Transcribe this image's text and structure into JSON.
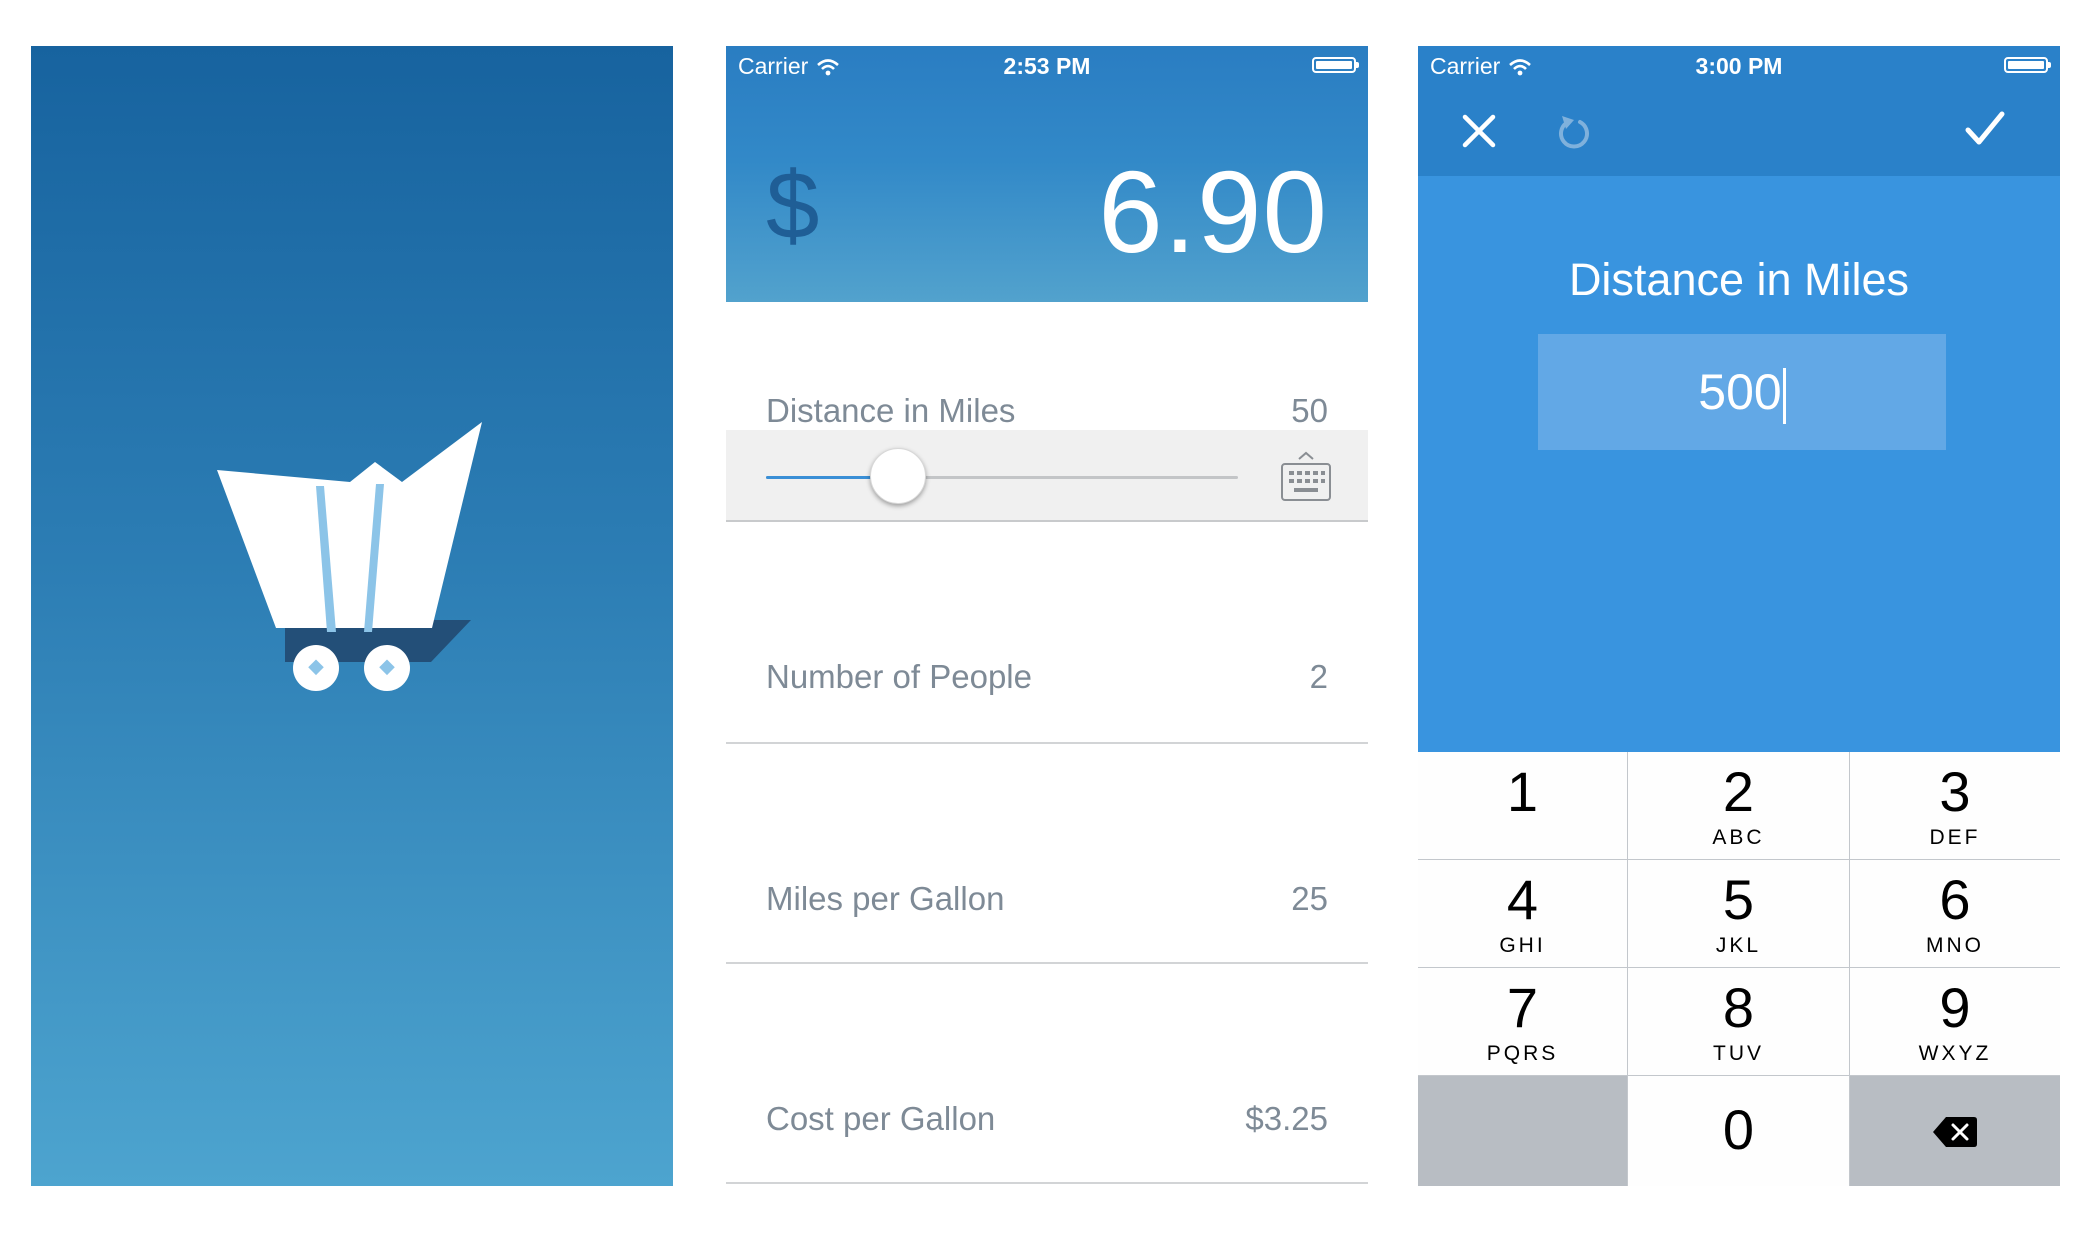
{
  "splash": {
    "colors": {
      "top": "#17639f",
      "bottom": "#4da4cf"
    },
    "logo_icon": "wagon-cart-logo-icon"
  },
  "calculator": {
    "status": {
      "carrier": "Carrier",
      "time": "2:53 PM"
    },
    "currency_symbol": "$",
    "total": "6.90",
    "rows": [
      {
        "label": "Distance in Miles",
        "value": "50"
      },
      {
        "label": "Number of People",
        "value": "2"
      },
      {
        "label": "Miles per Gallon",
        "value": "25"
      },
      {
        "label": "Cost per Gallon",
        "value": "$3.25"
      }
    ],
    "slider": {
      "fraction": 0.28
    },
    "keyboard_toggle_icon": "keyboard-icon",
    "colors": {
      "header_top": "#2a7dc2",
      "header_bottom": "#52a2cd",
      "text": "#7e8a96"
    }
  },
  "entry": {
    "status": {
      "carrier": "Carrier",
      "time": "3:00 PM"
    },
    "toolbar": {
      "close_icon": "close-icon",
      "reset_icon": "undo-icon",
      "confirm_icon": "checkmark-icon"
    },
    "title": "Distance in Miles",
    "input_value": "500",
    "keys": [
      {
        "num": "1",
        "letters": ""
      },
      {
        "num": "2",
        "letters": "ABC"
      },
      {
        "num": "3",
        "letters": "DEF"
      },
      {
        "num": "4",
        "letters": "GHI"
      },
      {
        "num": "5",
        "letters": "JKL"
      },
      {
        "num": "6",
        "letters": "MNO"
      },
      {
        "num": "7",
        "letters": "PQRS"
      },
      {
        "num": "8",
        "letters": "TUV"
      },
      {
        "num": "9",
        "letters": "WXYZ"
      },
      {
        "num": "0",
        "letters": ""
      }
    ],
    "delete_icon": "backspace-icon",
    "colors": {
      "background": "#3994df",
      "toolbar": "#2a81c9",
      "input": "#62a8e6"
    }
  }
}
